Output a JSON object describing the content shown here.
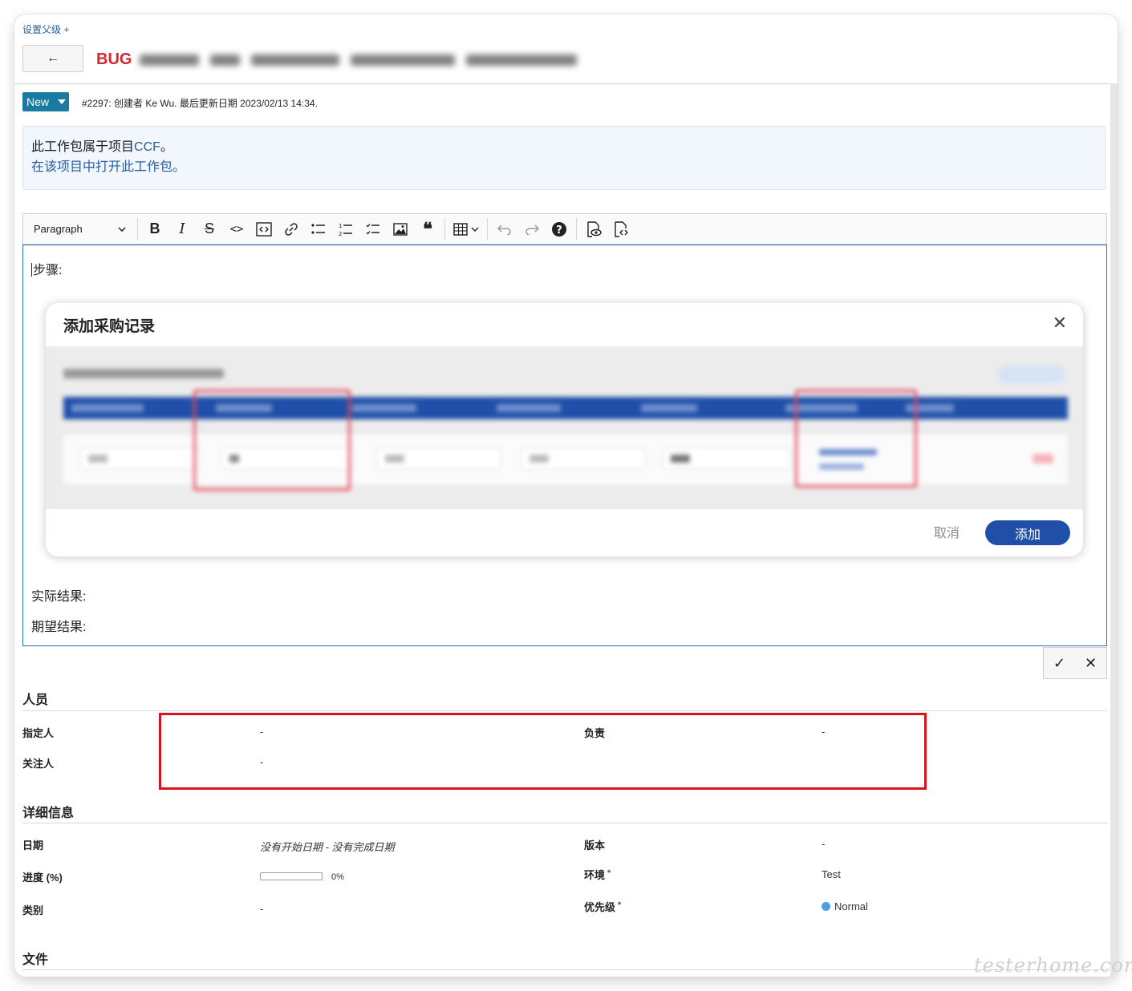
{
  "header": {
    "set_parent": "设置父级",
    "set_parent_plus": "+",
    "back_arrow": "←",
    "type": "BUG",
    "status": "New",
    "meta": "#2297: 创建者 Ke Wu. 最后更新日期 2023/02/13 14:34."
  },
  "info": {
    "line1_prefix": "此工作包属于项目",
    "project_link": "CCF",
    "line1_suffix": "。",
    "open_link": "在该项目中打开此工作包。"
  },
  "toolbar": {
    "paragraph_select": "Paragraph",
    "icons": [
      "bold-icon",
      "italic-icon",
      "strikethrough-icon",
      "code-icon",
      "code-block-icon",
      "link-icon",
      "bulleted-list-icon",
      "numbered-list-icon",
      "todo-list-icon",
      "image-icon",
      "blockquote-icon",
      "table-icon",
      "undo-icon",
      "redo-icon",
      "help-icon",
      "preview-icon",
      "source-icon"
    ]
  },
  "editor": {
    "steps_label": "步骤:",
    "actual_label": "实际结果:",
    "expected_label": "期望结果:",
    "embedded_dialog": {
      "title": "添加采购记录",
      "close": "✕",
      "cancel": "取消",
      "add": "添加"
    }
  },
  "edit_actions": {
    "save": "✓",
    "cancel": "✕"
  },
  "people": {
    "title": "人员",
    "assignee_label": "指定人",
    "assignee_value": "-",
    "responsible_label": "负责",
    "responsible_value": "-",
    "watcher_label": "关注人",
    "watcher_value": "-"
  },
  "details": {
    "title": "详细信息",
    "date_label": "日期",
    "date_value": "没有开始日期 - 没有完成日期",
    "version_label": "版本",
    "version_value": "-",
    "progress_label": "进度 (%)",
    "progress_value": "0%",
    "progress_fraction": 0,
    "env_label": "环境",
    "env_required": "*",
    "env_value": "Test",
    "category_label": "类别",
    "category_value": "-",
    "priority_label": "优先级",
    "priority_required": "*",
    "priority_value": "Normal",
    "priority_color": "#4a9ee8"
  },
  "files": {
    "title": "文件"
  },
  "colors": {
    "type_red": "#d42731",
    "status_teal": "#1a7ba0",
    "link_blue": "#2a5d9f",
    "highlight_red": "#d9141c",
    "dialog_primary": "#1f4fa8"
  },
  "watermark": "testerhome.com"
}
